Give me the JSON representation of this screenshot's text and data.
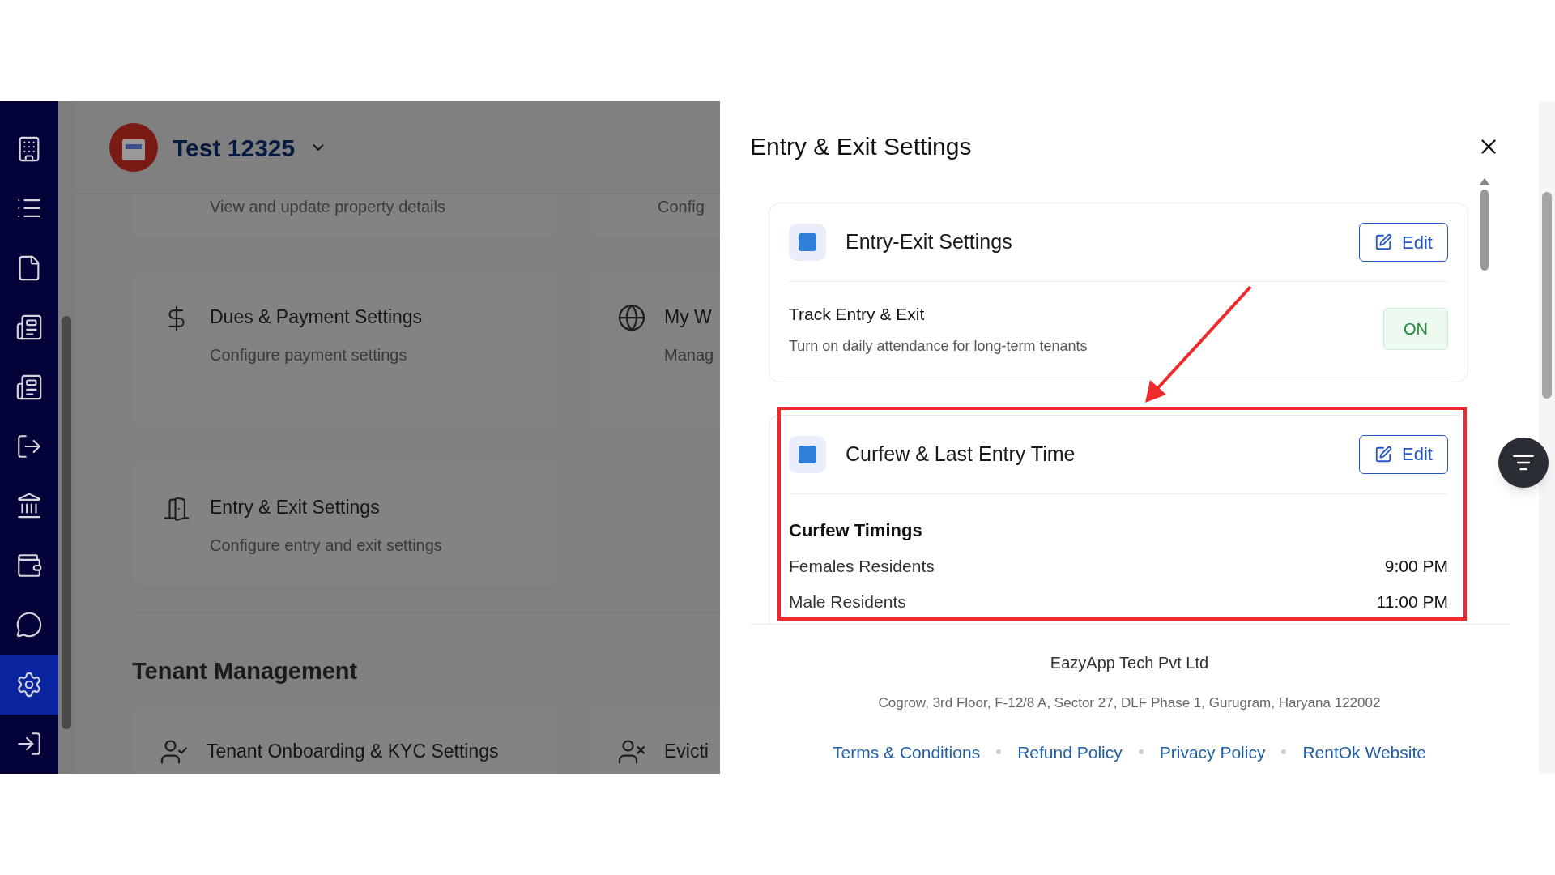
{
  "sidebar": {
    "items": [
      {
        "kind": "building",
        "selected": false
      },
      {
        "kind": "list",
        "selected": false
      },
      {
        "kind": "file",
        "selected": false
      },
      {
        "kind": "newspaper",
        "selected": false
      },
      {
        "kind": "newspaper",
        "selected": false
      },
      {
        "kind": "logout",
        "selected": false
      },
      {
        "kind": "bank",
        "selected": false
      },
      {
        "kind": "wallet",
        "selected": false
      },
      {
        "kind": "chat",
        "selected": false
      },
      {
        "kind": "settings",
        "selected": true
      },
      {
        "kind": "login",
        "selected": false
      }
    ]
  },
  "header": {
    "property_name": "Test 12325"
  },
  "settings_cards": [
    {
      "kind": "property",
      "description": "View and update property details",
      "cut_description": "Config"
    },
    {
      "kind": "payment",
      "title": "Dues & Payment Settings",
      "description": "Configure payment settings",
      "cut_title": "My W",
      "cut_description": "Manag"
    },
    {
      "kind": "entry",
      "title": "Entry & Exit Settings",
      "description": "Configure entry and exit settings"
    }
  ],
  "section_heading": "Tenant Management",
  "tenant_cards": [
    {
      "title": "Tenant Onboarding & KYC Settings",
      "cut_title": "Evicti"
    }
  ],
  "panel": {
    "title": "Entry & Exit Settings",
    "sections": [
      {
        "title": "Entry-Exit Settings",
        "button": "Edit",
        "rows": [
          {
            "kind": "toggle",
            "label": "Track Entry & Exit",
            "description": "Turn on daily attendance for long-term tenants",
            "value": "ON",
            "on": true
          }
        ]
      },
      {
        "title": "Curfew & Last Entry Time",
        "button": "Edit",
        "subheading": "Curfew Timings",
        "rows": [
          {
            "kind": "time",
            "label": "Females Residents",
            "value": "9:00 PM"
          },
          {
            "kind": "time",
            "label": "Male Residents",
            "value": "11:00 PM"
          }
        ]
      }
    ],
    "footer": {
      "company": "EazyApp Tech Pvt Ltd",
      "address": "Cogrow, 3rd Floor, F-12/8 A, Sector 27, DLF Phase 1, Gurugram, Haryana 122002",
      "links": [
        "Terms & Conditions",
        "Refund Policy",
        "Privacy Policy",
        "RentOk Website"
      ]
    }
  }
}
